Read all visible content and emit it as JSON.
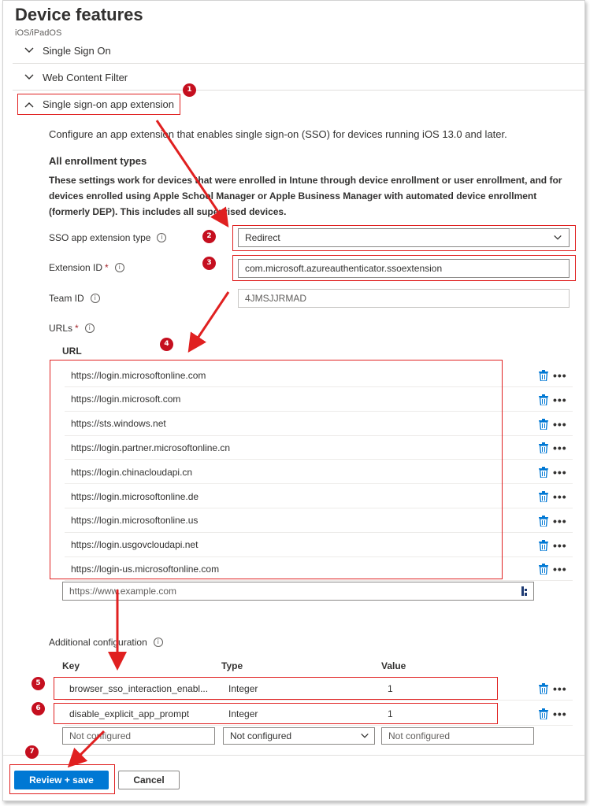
{
  "header": {
    "title": "Device features",
    "subtitle": "iOS/iPadOS"
  },
  "sections": [
    {
      "label": "Single Sign On",
      "expanded": false
    },
    {
      "label": "Web Content Filter",
      "expanded": false
    },
    {
      "label": "Single sign-on app extension",
      "expanded": true
    }
  ],
  "ssoext": {
    "description": "Configure an app extension that enables single sign-on (SSO) for devices running iOS 13.0 and later.",
    "enroll_heading": "All enrollment types",
    "enroll_text": "These settings work for devices that were enrolled in Intune through device enrollment or user enrollment, and for devices enrolled using Apple School Manager or Apple Business Manager with automated device enrollment (formerly DEP). This includes all supervised devices.",
    "type_label": "SSO app extension type",
    "type_value": "Redirect",
    "extid_label": "Extension ID",
    "extid_value": "com.microsoft.azureauthenticator.ssoextension",
    "teamid_label": "Team ID",
    "teamid_value": "4JMSJJRMAD",
    "urls_label": "URLs",
    "url_col": "URL",
    "urls": [
      "https://login.microsoftonline.com",
      "https://login.microsoft.com",
      "https://sts.windows.net",
      "https://login.partner.microsoftonline.cn",
      "https://login.chinacloudapi.cn",
      "https://login.microsoftonline.de",
      "https://login.microsoftonline.us",
      "https://login.usgovcloudapi.net",
      "https://login-us.microsoftonline.com"
    ],
    "url_placeholder": "https://www.example.com",
    "addl_label": "Additional configuration",
    "cols": {
      "key": "Key",
      "type": "Type",
      "value": "Value"
    },
    "config": [
      {
        "key": "browser_sso_interaction_enabl...",
        "type": "Integer",
        "value": "1"
      },
      {
        "key": "disable_explicit_app_prompt",
        "type": "Integer",
        "value": "1"
      }
    ],
    "new_row": {
      "key": "Not configured",
      "type": "Not configured",
      "value": "Not configured"
    }
  },
  "footer": {
    "primary": "Review + save",
    "secondary": "Cancel"
  },
  "callouts": [
    "1",
    "2",
    "3",
    "4",
    "5",
    "6",
    "7"
  ],
  "colors": {
    "accent": "#0078d4",
    "annotation": "#e02020",
    "required": "#a4262c"
  }
}
